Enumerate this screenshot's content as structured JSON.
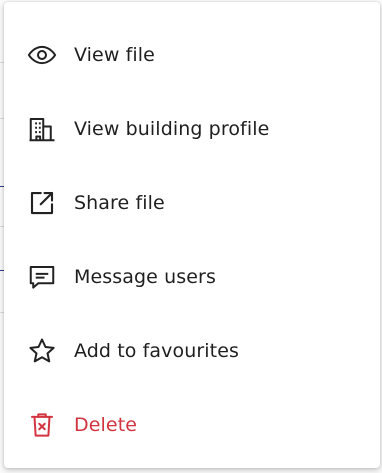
{
  "menu": {
    "items": [
      {
        "label": "View file",
        "icon": "eye-icon"
      },
      {
        "label": "View building profile",
        "icon": "building-icon"
      },
      {
        "label": "Share file",
        "icon": "external-link-icon"
      },
      {
        "label": "Message users",
        "icon": "message-icon"
      },
      {
        "label": "Add to favourites",
        "icon": "star-icon"
      },
      {
        "label": "Delete",
        "icon": "trash-icon"
      }
    ]
  },
  "colors": {
    "text": "#1f1f1f",
    "icon": "#222222",
    "danger": "#d2353f",
    "menu_background": "#ffffff"
  }
}
